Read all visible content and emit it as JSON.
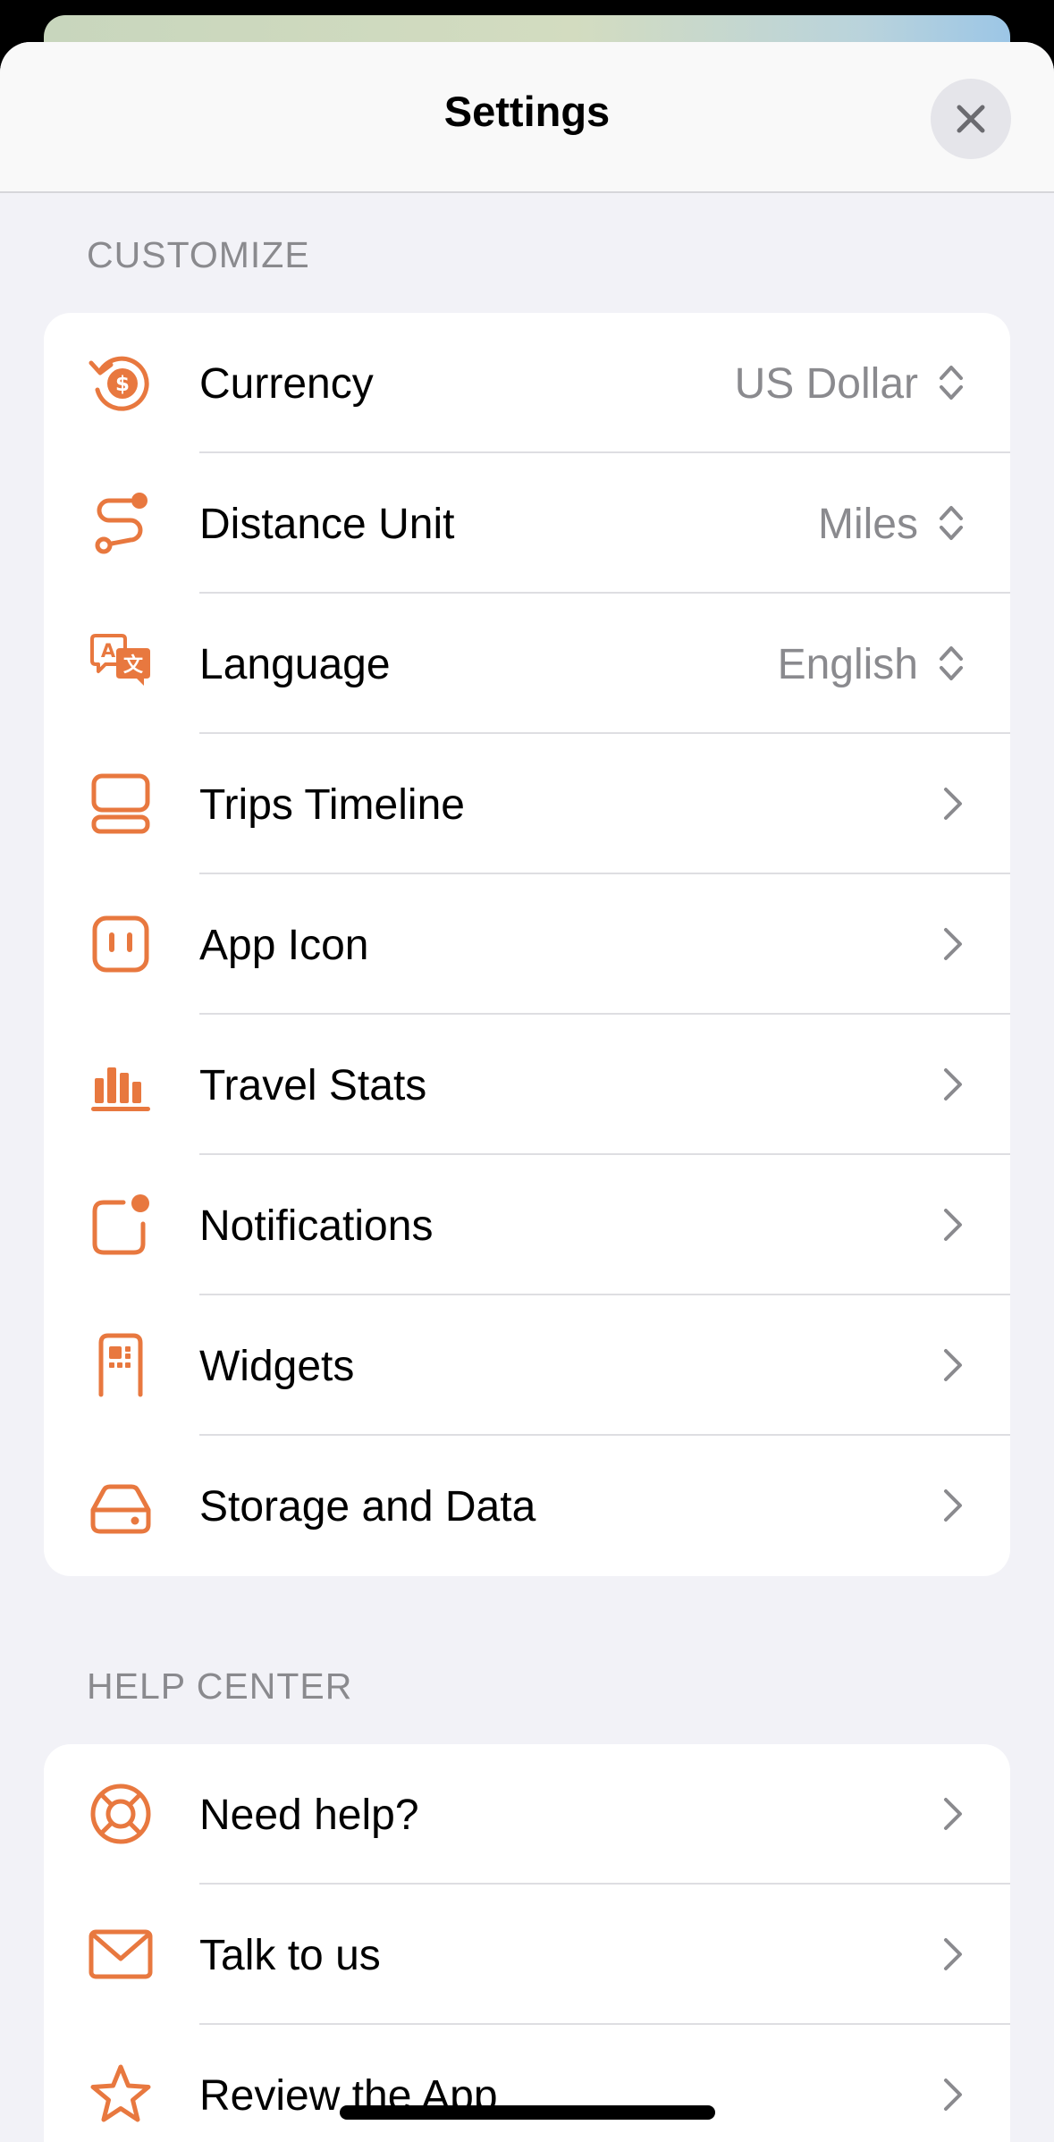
{
  "sheet": {
    "title": "Settings",
    "close_icon": "close-icon"
  },
  "accent_color": "#e8783f",
  "customize": {
    "header": "CUSTOMIZE",
    "rows": [
      {
        "label": "Currency",
        "value": "US Dollar",
        "icon": "currency-refresh-icon",
        "control": "picker"
      },
      {
        "label": "Distance Unit",
        "value": "Miles",
        "icon": "route-icon",
        "control": "picker"
      },
      {
        "label": "Language",
        "value": "English",
        "icon": "translate-icon",
        "control": "picker"
      },
      {
        "label": "Trips Timeline",
        "icon": "timeline-icon",
        "control": "chevron"
      },
      {
        "label": "App Icon",
        "icon": "app-icon-icon",
        "control": "chevron"
      },
      {
        "label": "Travel Stats",
        "icon": "bar-chart-icon",
        "control": "chevron"
      },
      {
        "label": "Notifications",
        "icon": "notification-badge-icon",
        "control": "chevron"
      },
      {
        "label": "Widgets",
        "icon": "widget-icon",
        "control": "chevron"
      },
      {
        "label": "Storage and Data",
        "icon": "drive-icon",
        "control": "chevron"
      }
    ]
  },
  "help_center": {
    "header": "HELP CENTER",
    "rows": [
      {
        "label": "Need help?",
        "icon": "lifebuoy-icon",
        "control": "chevron"
      },
      {
        "label": "Talk to us",
        "icon": "envelope-icon",
        "control": "chevron"
      },
      {
        "label": "Review the App",
        "icon": "star-icon",
        "control": "chevron"
      }
    ]
  }
}
